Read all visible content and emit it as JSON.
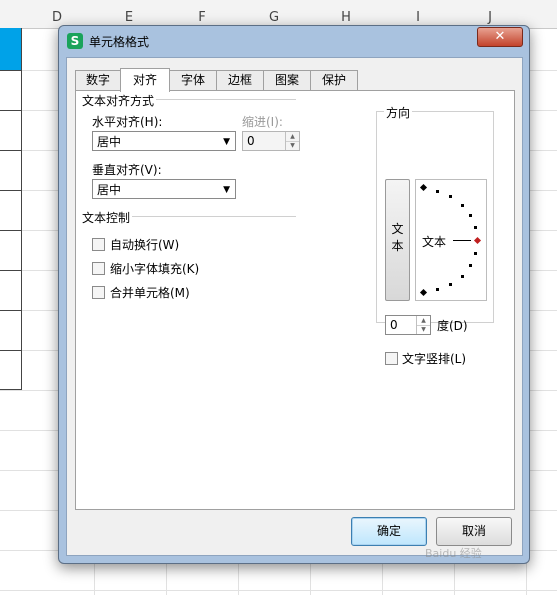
{
  "sheet": {
    "columns": [
      "D",
      "E",
      "F",
      "G",
      "H",
      "I",
      "J"
    ]
  },
  "dialog": {
    "title": "单元格格式",
    "icon_letter": "S",
    "close_glyph": "✕",
    "tabs": [
      {
        "label": "数字",
        "active": false
      },
      {
        "label": "对齐",
        "active": true
      },
      {
        "label": "字体",
        "active": false
      },
      {
        "label": "边框",
        "active": false
      },
      {
        "label": "图案",
        "active": false
      },
      {
        "label": "保护",
        "active": false
      }
    ],
    "text_alignment": {
      "group_title": "文本对齐方式",
      "horizontal_label": "水平对齐(H):",
      "horizontal_value": "居中",
      "indent_label": "缩进(I):",
      "indent_value": "0",
      "vertical_label": "垂直对齐(V):",
      "vertical_value": "居中"
    },
    "text_control": {
      "group_title": "文本控制",
      "options": [
        {
          "label": "自动换行(W)",
          "checked": false
        },
        {
          "label": "缩小字体填充(K)",
          "checked": false
        },
        {
          "label": "合并单元格(M)",
          "checked": false
        }
      ]
    },
    "orientation": {
      "group_title": "方向",
      "vertical_text_chars": [
        "文",
        "本"
      ],
      "dial_text": "文本",
      "degree_value": "0",
      "degree_label": "度(D)",
      "vertical_checkbox_label": "文字竖排(L)"
    },
    "ok_label": "确定",
    "cancel_label": "取消",
    "accent_color": "#3c7fb1"
  },
  "watermark": "Baidu 经验"
}
